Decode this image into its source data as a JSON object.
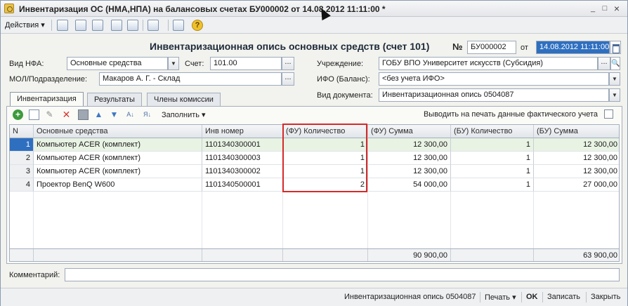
{
  "window": {
    "title": "Инвентаризация ОС (НМА,НПА) на балансовых счетах БУ000002 от 14.08.2012 11:11:00 *",
    "minimize": "_",
    "maximize": "□",
    "close": "×"
  },
  "toolbar": {
    "actions_label": "Действия ▾",
    "help": "?"
  },
  "header": {
    "doc_title": "Инвентаризационная опись основных средств (счет 101)",
    "number_label": "№",
    "number_value": "БУ000002",
    "date_label": "от",
    "date_value": "14.08.2012 11:11:00",
    "nfa_type_label": "Вид НФА:",
    "nfa_type_value": "Основные средства",
    "account_label": "Счет:",
    "account_value": "101.00",
    "mol_label": "МОЛ/Подразделение:",
    "mol_value": "Макаров А. Г. - Склад",
    "institution_label": "Учреждение:",
    "institution_value": "ГОБУ ВПО Университет искусств (Субсидия)",
    "ifo_label": "ИФО (Баланс):",
    "ifo_value": "<без учета ИФО>",
    "doctype_label": "Вид документа:",
    "doctype_value": "Инвентаризационная опись 0504087",
    "ellipsis": "..."
  },
  "tabs": [
    {
      "label": "Инвентаризация"
    },
    {
      "label": "Результаты"
    },
    {
      "label": "Члены комиссии"
    }
  ],
  "table_toolbar": {
    "fill_label": "Заполнить ▾",
    "print_actual_label": "Выводить на печать данные фактического учета"
  },
  "table": {
    "columns": [
      "N",
      "Основные средства",
      "Инв номер",
      "(ФУ) Количество",
      "(ФУ) Сумма",
      "(БУ) Количество",
      "(БУ) Сумма"
    ],
    "rows": [
      {
        "n": "1",
        "asset": "Компьютер ACER (комплект)",
        "inv": "1101340300001",
        "fu_qty": "1",
        "fu_sum": "12 300,00",
        "bu_qty": "1",
        "bu_sum": "12 300,00"
      },
      {
        "n": "2",
        "asset": "Компьютер ACER (комплект)",
        "inv": "1101340300003",
        "fu_qty": "1",
        "fu_sum": "12 300,00",
        "bu_qty": "1",
        "bu_sum": "12 300,00"
      },
      {
        "n": "3",
        "asset": "Компьютер ACER (комплект)",
        "inv": "1101340300002",
        "fu_qty": "1",
        "fu_sum": "12 300,00",
        "bu_qty": "1",
        "bu_sum": "12 300,00"
      },
      {
        "n": "4",
        "asset": "Проектор BenQ W600",
        "inv": "1101340500001",
        "fu_qty": "2",
        "fu_sum": "54 000,00",
        "bu_qty": "1",
        "bu_sum": "27 000,00"
      }
    ],
    "totals": {
      "fu_sum": "90 900,00",
      "bu_sum": "63 900,00"
    }
  },
  "footer": {
    "comment_label": "Комментарий:",
    "print_form": "Инвентаризационная опись 0504087",
    "print_label": "Печать ▾",
    "ok_label": "OK",
    "save_label": "Записать",
    "close_label": "Закрыть"
  }
}
